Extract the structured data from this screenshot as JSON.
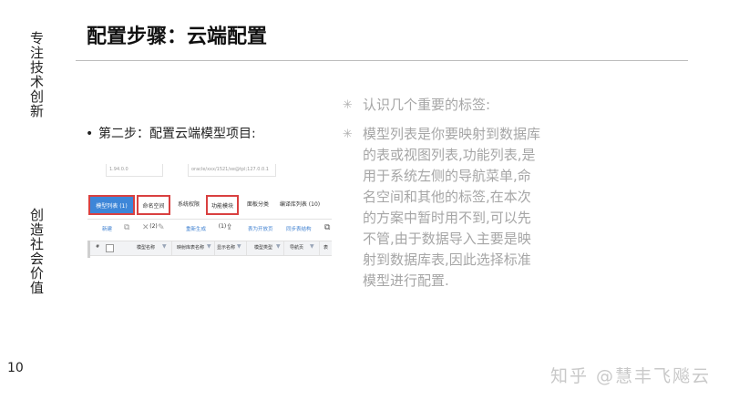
{
  "slide": {
    "title": "配置步骤：云端配置",
    "side_top": "专注技术创新",
    "side_bottom": "创造社会价值",
    "page_number": "10",
    "watermark": "知乎 @慧丰飞飚云"
  },
  "step": {
    "bullet": "•",
    "text": "第二步：配置云端模型项目:"
  },
  "notes": [
    {
      "star": "✳",
      "text": "认识几个重要的标签:"
    },
    {
      "star": "✳",
      "text": "模型列表是你要映射到数据库的表或视图列表,功能列表,是用于系统左侧的导航菜单,命名空间和其他的标签,在本次的方案中暂时用不到,可以先不管,由于数据导入主要是映射到数据库表,因此选择标准模型进行配置."
    }
  ],
  "screenshot": {
    "form_fields": [
      "1.94.0.0",
      "oracle/xxx/1521/xe@tpl;127.0.0.1"
    ],
    "tabs": [
      {
        "label": "模型列表 (1)",
        "active": true,
        "highlighted": true
      },
      {
        "label": "命名空间 (2)",
        "active": false,
        "highlighted": true
      },
      {
        "label": "系统权限",
        "active": false,
        "highlighted": false
      },
      {
        "label": "功能模块 (1)",
        "active": false,
        "highlighted": true
      },
      {
        "label": "面板分类",
        "active": false,
        "highlighted": false
      },
      {
        "label": "编译库列表 (10)",
        "active": false,
        "highlighted": false
      }
    ],
    "toolbar": {
      "new_label": "新建",
      "copy_icon": "copy-icon",
      "delete_icon": "close-icon",
      "edit_icon": "pencil-icon",
      "rebuild_label": "重新生成",
      "export_icon": "export-icon",
      "table_label": "表为开放页",
      "sync_label": "同步表结构",
      "more_icon": "copy-icon"
    },
    "columns": [
      "#",
      "模型名称",
      "映射库表名称",
      "显示名称",
      "模型类型",
      "导航页",
      "表"
    ]
  }
}
